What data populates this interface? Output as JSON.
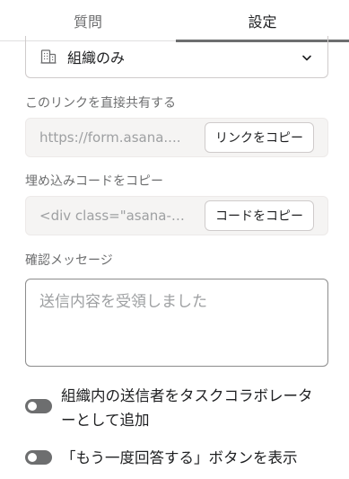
{
  "tabs": [
    {
      "label": "質問",
      "active": false
    },
    {
      "label": "設定",
      "active": true
    }
  ],
  "visibility": {
    "selected": "組織のみ",
    "icon": "building-icon"
  },
  "share_link": {
    "label": "このリンクを直接共有する",
    "value": "https://form.asana....",
    "button": "リンクをコピー"
  },
  "embed_code": {
    "label": "埋め込みコードをコピー",
    "value": "<div class=\"asana-e...",
    "button": "コードをコピー"
  },
  "confirmation": {
    "label": "確認メッセージ",
    "placeholder": "送信内容を受領しました"
  },
  "toggles": [
    {
      "line1": "組織内の送信者をタスクコラボレータ",
      "line2": "ーとして追加",
      "on": false
    },
    {
      "line1": "「もう一度回答する」ボタンを表示",
      "on": false
    }
  ],
  "colors": {
    "text": "#1e1f21",
    "muted": "#6d6e6f",
    "placeholder": "#9ea0a2",
    "field_bg": "#f5f4f3",
    "toggle_off": "#6d6e6f"
  }
}
